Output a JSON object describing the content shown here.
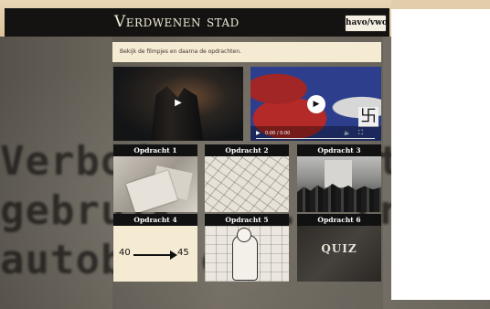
{
  "header": {
    "title": "Verdwenen stad",
    "level_button": "havo/vwo"
  },
  "instruction": "Bekijk de filmpjes en daarna de opdrachten.",
  "background": {
    "text_lines": [
      "Verbod  ...  tot",
      "gebruik  ...  tram",
      "autobussen  ...  en  de"
    ]
  },
  "video2": {
    "time": "0:00 / 0:00"
  },
  "tiles": [
    {
      "label": "Opdracht 1"
    },
    {
      "label": "Opdracht 2"
    },
    {
      "label": "Opdracht 3"
    },
    {
      "label": "Opdracht 4",
      "from": "40",
      "to": "45"
    },
    {
      "label": "Opdracht 5"
    },
    {
      "label": "Opdracht 6",
      "image_text": "QUIZ"
    }
  ],
  "colors": {
    "header_bg": "#141311",
    "instruction_bg": "#f5ebd3",
    "tile_label_bg": "#111111"
  }
}
